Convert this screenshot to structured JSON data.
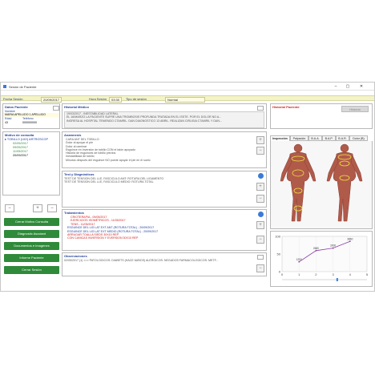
{
  "window": {
    "title": "Sesión de Paciente"
  },
  "session": {
    "fecha_label": "Fecha Sesión",
    "fecha_value": "20/09/2017",
    "hora_label": "Hora Sesión",
    "hora_value": "03:30",
    "tipo_label": "Tipo de sesión",
    "tipo_value": "Normal"
  },
  "patient": {
    "header": "Datos Paciente",
    "name_label": "Nombre",
    "name_value": "MARIA APELLIDO 1 APELLIDO",
    "age_label": "Edad",
    "age_value": "43",
    "phone_label": "Teléfono",
    "phone_value": "000000000"
  },
  "consultas": {
    "header": "Motivo de consulta",
    "root": "TOBILLO (UIO) ARTROSCOP",
    "dates": [
      "02/05/2017",
      "09/05/2017",
      "11/05/2017",
      "20/09/2017"
    ]
  },
  "buttons": {
    "minus": "−",
    "plus": "+",
    "cerrar_consulta": "Cerrar Motivo Consulta",
    "diagnostico": "Diagnostic Asociant",
    "documentos": "Documentos e Imagenes",
    "informe": "Informe Paciente",
    "cerrar_sesion": "Cerrar Sesión",
    "historial_btn": "Historia"
  },
  "historial_medico": {
    "header": "Historial Médico",
    "lines": [
      "19/03/2017 - INESTABILIDAD LATERAL",
      "EL 16/MARZO LA PACIENTE SUFRE UNA TROMBOSIS PROFUNDA TRATADA EN EL ISSTE. POR EL DOLOR NO A...",
      "INGRESA AL HOSPITAL TENIENDO CTAMRIL. DAN DIAGNOSTICO 13 ABRIL. REALIZAN CIRUGIA CTAMRIL Y DAN..."
    ]
  },
  "historial_paciente": {
    "header": "Historial Paciente"
  },
  "anamnesis": {
    "header": "Anamnesis",
    "lines": [
      "CARA ANT DEL TOBILLO",
      "Dolor al apoyar el pie",
      "Dolor al caminar",
      "Esguince en inversión de tobillo CON el talón apoyado",
      "Historia de esguinces de tobillo previos",
      "Inestabilidad de tobillo",
      "Minutos después del esguince NO puede apoyar el pie en el suelo"
    ]
  },
  "test": {
    "header": "Test y Diagnósticos",
    "lines": [
      "TEST DE TENSION DEL LLE, FASCICULO ANT: ROTURA DEL LIGAMENTO",
      "TEST DE TENSION DEL LLE, FASCICULO MEDIO: ROTURA TOTAL"
    ]
  },
  "tratamientos": {
    "header": "Tratamientos",
    "items": [
      {
        "text": "CRIOTERAPIA - 09/05/2017",
        "color": "#d02020"
      },
      {
        "text": "EJERCICIOS ISOMÉTRICOS - 11/05/2017",
        "color": "#d02020"
      },
      {
        "text": "TENS - 11/05/2017",
        "color": "#d02020"
      },
      {
        "text": "ESGUINCE DEL LIG LAT EXT ANT (ROTURA TOTAL) - 20/09/2017",
        "color": "#1f3c9a"
      },
      {
        "text": "ESGUINCE DEL LIG LAT EXT MEDIO (ROTURA TOTAL) - 20/09/2017",
        "color": "#1f3c9a"
      },
      {
        "text": "ARRUGAR TOALLA SIEDS 30X10 REP",
        "color": "#d02020"
      },
      {
        "text": "CON CANICAS INVERSION Y EVERSION 30X10 REP",
        "color": "#d02020"
      }
    ]
  },
  "observaciones": {
    "header": "Observaciones",
    "line": "02/05/2017 (1) >>> PATOLOGICOS: DIABETS (HACE 6AÑOS) ALERGICOS: NEGADOS FARMACOLOGICOS: METF..."
  },
  "tabs": [
    "Inspección",
    "Palpación",
    "B.A.A.",
    "B.A.P.",
    "B.A.R.",
    "Dolor (B)"
  ],
  "chart_data": {
    "type": "line",
    "x": [
      1,
      2,
      3,
      4
    ],
    "y": [
      1250,
      2680,
      3000,
      3860
    ],
    "point_labels": [
      "1250",
      "2680",
      "3000",
      "3860"
    ],
    "xticks": [
      "0",
      "1",
      "2",
      "3",
      "4",
      "5"
    ],
    "yticks": [
      "0",
      "50",
      "100"
    ],
    "xlim": [
      0,
      5
    ],
    "color": "#8a3fa8"
  },
  "colors": {
    "green_button": "#2f8a3a",
    "session_bar": "#f3f3c8",
    "blue_label": "#1f3c9a"
  }
}
